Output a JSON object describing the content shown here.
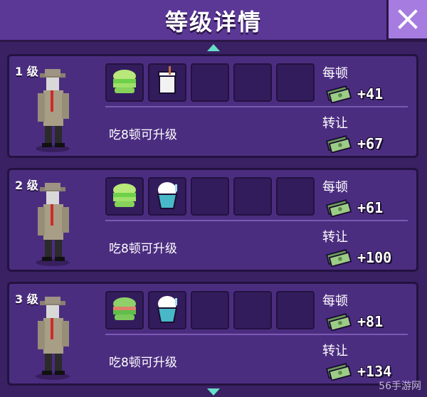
{
  "header": {
    "title": "等级详情",
    "close_icon": "close-icon"
  },
  "levels": [
    {
      "level": "1 级",
      "food": [
        "green-burger",
        "milkshake"
      ],
      "upgrade_text": "吃8顿可升级",
      "per_meal_label": "每顿",
      "per_meal_value": "+41",
      "transfer_label": "转让",
      "transfer_value": "+67"
    },
    {
      "level": "2 级",
      "food": [
        "green-burger",
        "ice-cream-cup"
      ],
      "upgrade_text": "吃8顿可升级",
      "per_meal_label": "每顿",
      "per_meal_value": "+61",
      "transfer_label": "转让",
      "transfer_value": "+100"
    },
    {
      "level": "3 级",
      "food": [
        "burger",
        "ice-cream-cup"
      ],
      "upgrade_text": "吃8顿可升级",
      "per_meal_label": "每顿",
      "per_meal_value": "+81",
      "transfer_label": "转让",
      "transfer_value": "+134"
    }
  ],
  "watermark": "56手游网",
  "colors": {
    "background": "#3a2163",
    "panel": "#4b2d80",
    "accent": "#66e0c8",
    "close_bg": "#a67ce0"
  }
}
